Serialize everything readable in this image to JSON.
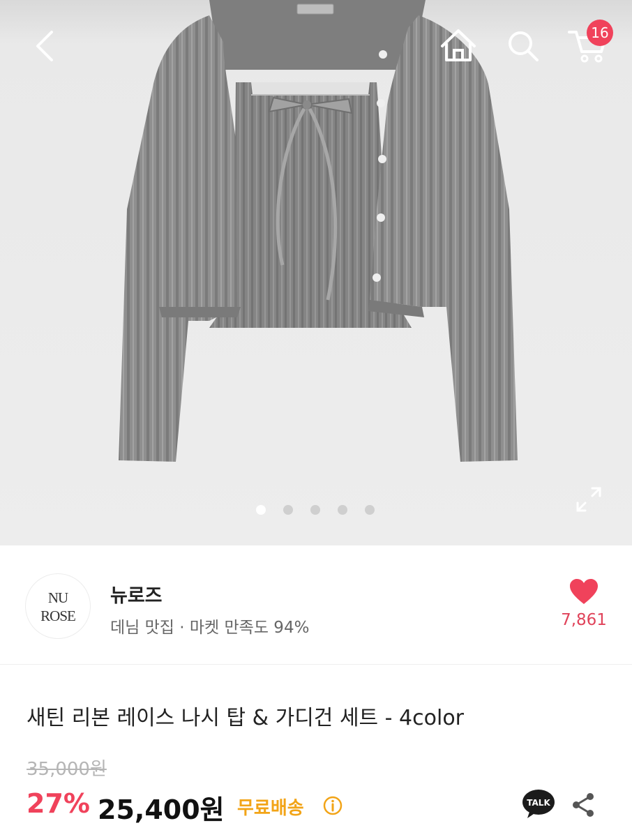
{
  "header": {
    "back_icon": "chevron-left-icon",
    "home_icon": "home-icon",
    "search_icon": "search-icon",
    "cart_icon": "cart-icon",
    "cart_count": "16"
  },
  "gallery": {
    "image_count": 5,
    "active_index": 0,
    "expand_icon": "expand-icon"
  },
  "seller": {
    "logo_line1": "NU",
    "logo_line2": "ROSE",
    "name": "뉴로즈",
    "description": "데님 맛집 · 마켓 만족도 94%",
    "likes": "7,861",
    "heart_color": "#f0425b"
  },
  "product": {
    "title": "새틴 리본 레이스 나시 탑 & 가디건 세트 - 4color",
    "original_price": "35,000원",
    "discount": "27%",
    "price": "25,400원",
    "free_shipping": "무료배송"
  },
  "actions": {
    "talk_label": "TALK",
    "share_icon": "share-icon"
  },
  "colors": {
    "accent": "#f0425b",
    "shipping": "#f2a417"
  }
}
